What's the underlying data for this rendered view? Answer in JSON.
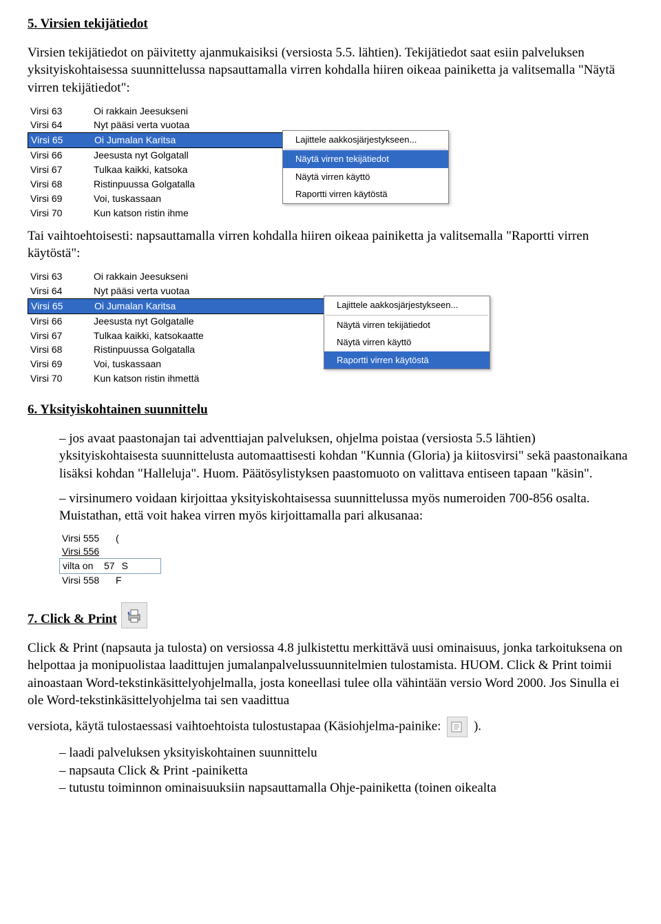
{
  "s5": {
    "heading": "5. Virsien tekijätiedot",
    "p1": "Virsien tekijätiedot on päivitetty ajanmukaisiksi (versiosta 5.5. lähtien). Tekijätiedot saat esiin palveluksen yksityiskohtaisessa suunnittelussa napsauttamalla virren kohdalla hiiren oikeaa painiketta ja valitsemalla \"Näytä virren tekijätiedot\":",
    "p2": "Tai vaihtoehtoisesti: napsauttamalla virren kohdalla hiiren oikeaa painiketta ja valitsemalla \"Raportti virren käytöstä\":"
  },
  "list_common": [
    {
      "num": "Virsi 63",
      "title": "Oi rakkain Jeesukseni"
    },
    {
      "num": "Virsi 64",
      "title": "Nyt pääsi verta vuotaa"
    },
    {
      "num": "Virsi 65",
      "title": "Oi Jumalan Karitsa",
      "sel": true
    },
    {
      "num": "Virsi 66",
      "title": "Jeesusta nyt Golgatall"
    },
    {
      "num": "Virsi 67",
      "title": "Tulkaa kaikki, katsoka"
    },
    {
      "num": "Virsi 68",
      "title": "Ristinpuussa Golgatalla"
    },
    {
      "num": "Virsi 69",
      "title": "Voi, tuskassaan"
    },
    {
      "num": "Virsi 70",
      "title": "Kun katson ristin ihme"
    }
  ],
  "list_b_row66": "Jeesusta nyt Golgatalle",
  "list_b_row67": "Tulkaa kaikki, katsokaatte",
  "list_b_row70": "Kun katson ristin ihmettä",
  "ctx": {
    "sort": "Lajittele aakkosjärjestykseen...",
    "showAuthor": "Näytä virren tekijätiedot",
    "showUsage": "Näytä virren käyttö",
    "report": "Raportti virren käytöstä"
  },
  "s6": {
    "heading": "6. Yksityiskohtainen suunnittelu",
    "b1": "– jos avaat paastonajan tai adventtiajan palveluksen, ohjelma poistaa (versiosta 5.5 lähtien) yksityiskohtaisesta suunnittelusta automaattisesti kohdan \"Kunnia (Gloria) ja kiitosvirsi\" sekä paastonaikana lisäksi kohdan \"Halleluja\". Huom. Päätösylistyksen paastomuoto on valittava entiseen tapaan \"käsin\".",
    "b2": "– virsinumero voidaan kirjoittaa yksityiskohtaisessa suunnittelussa myös numeroiden 700-856 osalta. Muistathan, että voit hakea virren myös kirjoittamalla pari alkusanaa:"
  },
  "small_list": [
    {
      "num": "Virsi 555",
      "tail": "("
    },
    {
      "num": "Virsi 556",
      "tail": ""
    },
    {
      "num": "vilta on",
      "num2": "57",
      "tail": "S",
      "input": true
    },
    {
      "num": "Virsi 558",
      "tail": "F"
    }
  ],
  "s7": {
    "heading": "7. Click & Print",
    "p1a": "Click & Print (napsauta ja tulosta) on versiossa 4.8 julkistettu merkittävä uusi ominaisuus, jonka tarkoituksena on helpottaa ja monipuolistaa laadittujen jumalanpalvelussuunnitelmien tulostamista. HUOM. Click & Print toimii ainoastaan Word-tekstinkäsittelyohjelmalla, josta koneellasi tulee olla vähintään versio Word 2000. Jos Sinulla ei ole Word-tekstinkäsittelyohjelma tai sen vaadittua",
    "p1b_before": "versiota, käytä tulostaessasi vaihtoehtoista tulostustapaa (Käsiohjelma-painike:",
    "p1b_after": ").",
    "b1": "– laadi palveluksen yksityiskohtainen suunnittelu",
    "b2": "– napsauta Click & Print -painiketta",
    "b3": "– tutustu toiminnon ominaisuuksiin napsauttamalla Ohje-painiketta (toinen oikealta"
  }
}
